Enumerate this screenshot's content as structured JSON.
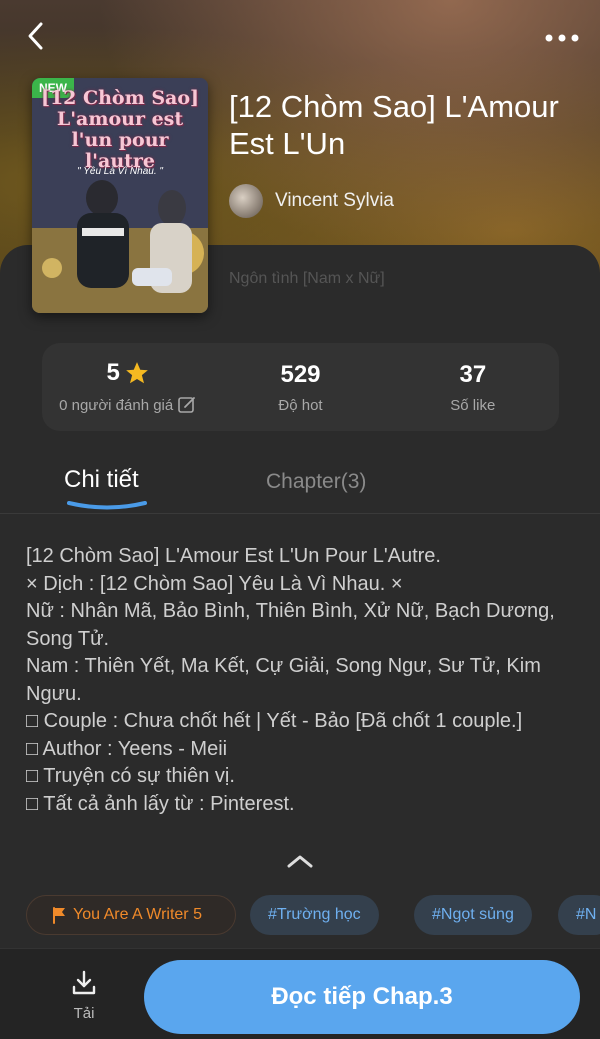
{
  "header": {
    "back_icon": "chevron-left-icon",
    "more_icon": "more-horizontal-icon"
  },
  "book": {
    "cover": {
      "badge": "NEW",
      "title_text": "[12 Chòm Sao] L'amour est l'un pour l'autre",
      "subtitle_text": "\" Yêu Là Vì Nhau. \""
    },
    "title": "[12 Chòm Sao] L'Amour Est L'Un",
    "author": "Vincent Sylvia",
    "genre": "Ngôn tình [Nam x Nữ]"
  },
  "stats": {
    "rating": {
      "value": "5",
      "label": "0 người đánh giá"
    },
    "hot": {
      "value": "529",
      "label": "Độ hot"
    },
    "likes": {
      "value": "37",
      "label": "Số like"
    }
  },
  "tabs": {
    "detail": "Chi tiết",
    "chapter": "Chapter(3)"
  },
  "description": {
    "lines": [
      "[12 Chòm Sao] L'Amour Est L'Un Pour L'Autre.",
      "× Dịch : [12 Chòm Sao] Yêu Là Vì Nhau. ×",
      "Nữ : Nhân Mã, Bảo Bình, Thiên Bình, Xử Nữ, Bạch Dương, Song Tử.",
      "Nam : Thiên Yết, Ma Kết, Cự Giải, Song Ngư, Sư Tử, Kim Ngưu.",
      "□ Couple : Chưa chốt hết | Yết - Bảo [Đã chốt 1 couple.]",
      "□ Author : Yeens - Meii",
      "□ Truyện có sự thiên vị.",
      "□ Tất cả ảnh lấy từ : Pinterest."
    ]
  },
  "chips": {
    "writer": "You Are A Writer 5",
    "tags": [
      "#Trường học",
      "#Ngọt sủng",
      "#N"
    ]
  },
  "bottom": {
    "download_label": "Tải",
    "read_button": "Đọc tiếp Chap.3"
  },
  "colors": {
    "accent_blue": "#5aa6ee",
    "writer_orange": "#f08a2a",
    "star_yellow": "#f5b921",
    "new_badge_green": "#3bb54a"
  }
}
